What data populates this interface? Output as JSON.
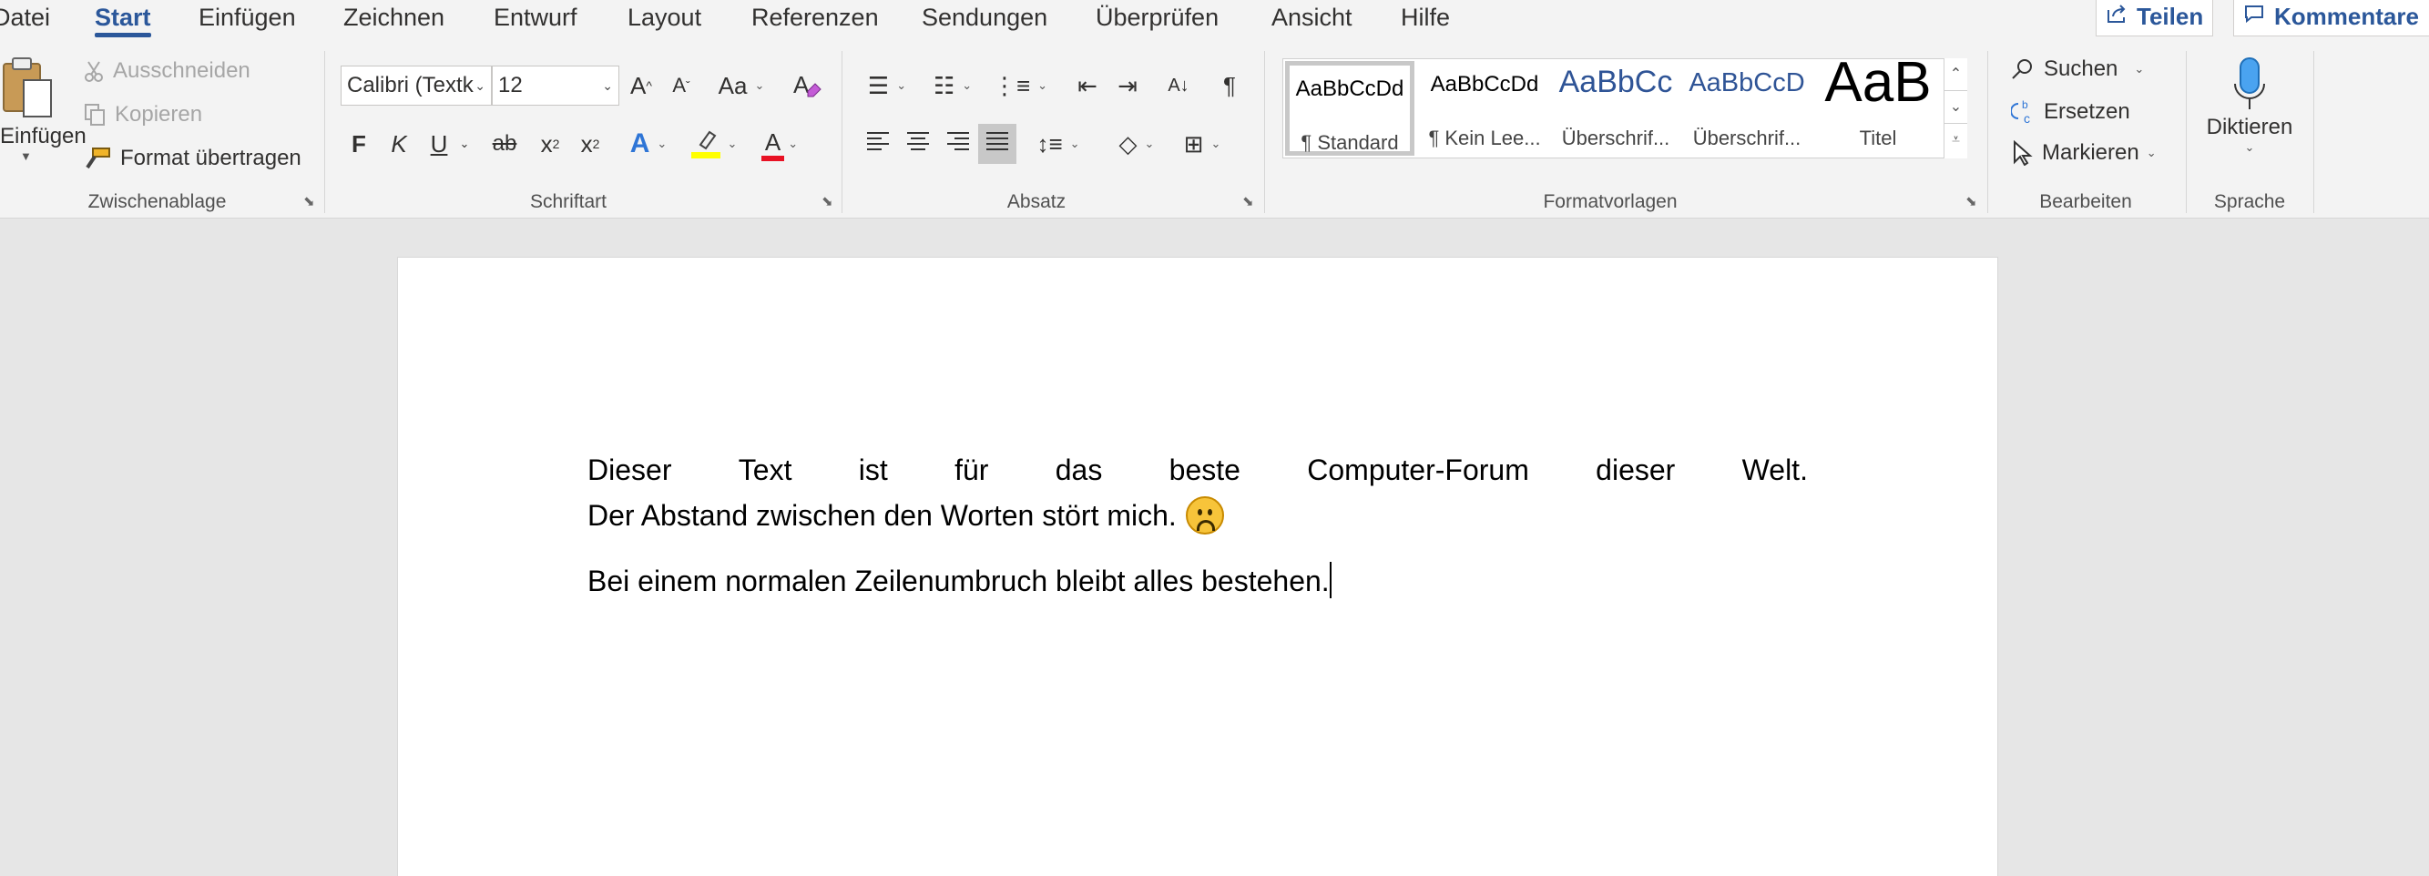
{
  "menu": {
    "tabs": [
      "Datei",
      "Start",
      "Einfügen",
      "Zeichnen",
      "Entwurf",
      "Layout",
      "Referenzen",
      "Sendungen",
      "Überprüfen",
      "Ansicht",
      "Hilfe"
    ],
    "active_tab": "Start",
    "share_label": "Teilen",
    "comments_label": "Kommentare"
  },
  "clipboard": {
    "paste_label": "Einfügen",
    "cut_label": "Ausschneiden",
    "copy_label": "Kopieren",
    "format_painter_label": "Format übertragen",
    "group_label": "Zwischenablage"
  },
  "font": {
    "font_name": "Calibri (Textk",
    "font_size": "12",
    "grow_label": "A",
    "shrink_label": "A",
    "case_label": "Aa",
    "bold": "F",
    "italic": "K",
    "underline": "U",
    "strike": "ab",
    "subscript": "x",
    "superscript": "x",
    "sub_mark": "2",
    "sup_mark": "2",
    "effects_label": "A",
    "color_label": "A",
    "group_label": "Schriftart",
    "highlight_color": "#ffff00",
    "font_color": "#e81123"
  },
  "paragraph": {
    "group_label": "Absatz",
    "pilcrow": "¶"
  },
  "styles": {
    "items": [
      {
        "sample": "AaBbCcDd",
        "name": "¶ Standard"
      },
      {
        "sample": "AaBbCcDd",
        "name": "¶ Kein Lee..."
      },
      {
        "sample": "AaBbCc",
        "name": "Überschrif..."
      },
      {
        "sample": "AaBbCcD",
        "name": "Überschrif..."
      },
      {
        "sample": "AaB",
        "name": "Titel"
      }
    ],
    "group_label": "Formatvorlagen"
  },
  "editing": {
    "find_label": "Suchen",
    "replace_label": "Ersetzen",
    "select_label": "Markieren",
    "group_label": "Bearbeiten"
  },
  "voice": {
    "dictate_label": "Diktieren",
    "group_label": "Sprache"
  },
  "document": {
    "line1_words": [
      "Dieser",
      "Text",
      "ist",
      "für",
      "das",
      "beste",
      "Computer-Forum",
      "dieser",
      "Welt."
    ],
    "line2": "Der Abstand zwischen den Worten stört mich.",
    "paragraph2": "Bei einem normalen Zeilenumbruch bleibt alles bestehen."
  },
  "colors": {
    "accent": "#2b579a",
    "ribbon_bg": "#f3f3f3",
    "canvas_bg": "#e6e6e6"
  }
}
